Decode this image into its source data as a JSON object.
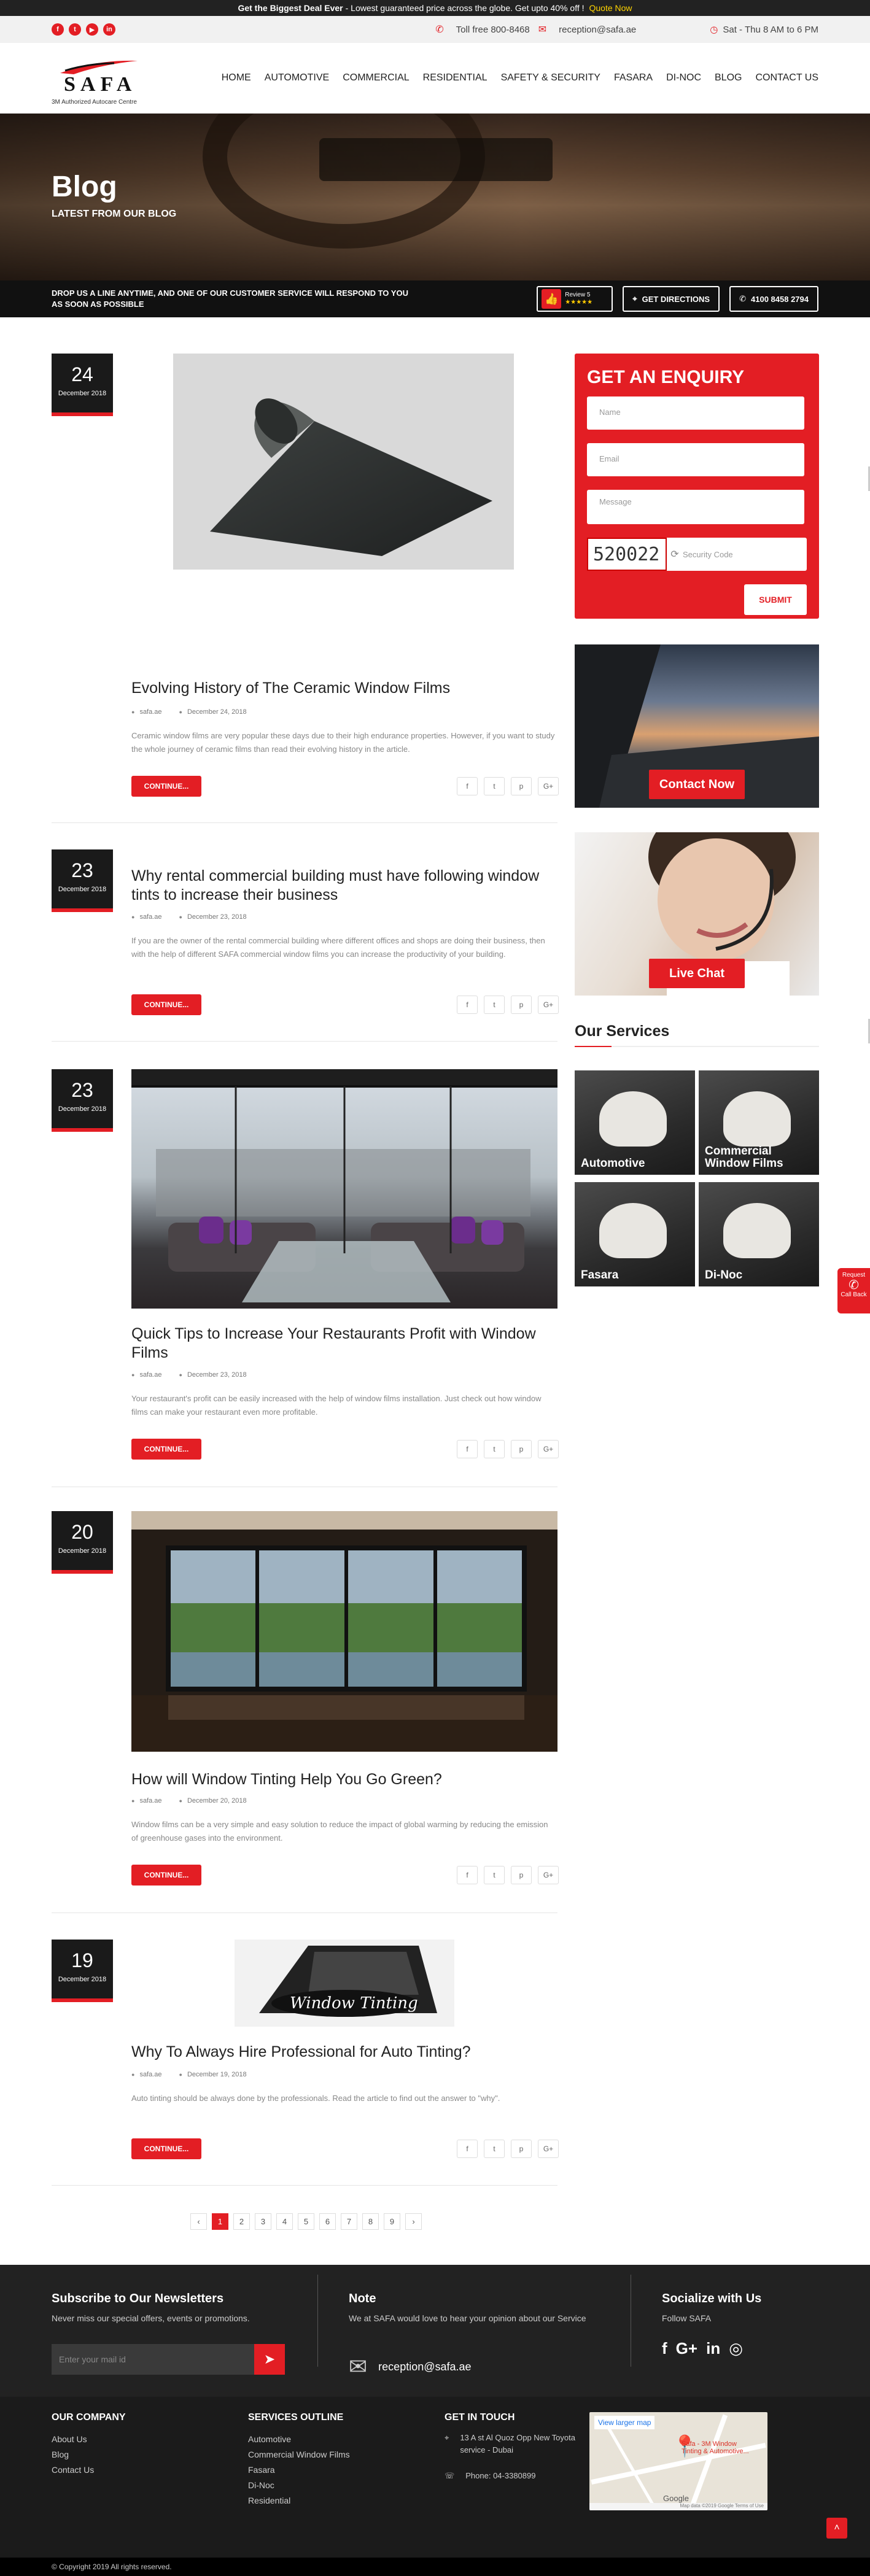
{
  "promo": {
    "bold": "Get the Biggest Deal Ever",
    "text": " - Lowest guaranteed price across the globe. Get upto 40% off !",
    "link": "Quote Now"
  },
  "topbar": {
    "social": [
      "f",
      "t",
      "▶",
      "in"
    ],
    "phone": "Toll free 800-8468",
    "email": "reception@safa.ae",
    "hours": "Sat - Thu 8 AM to 6 PM"
  },
  "logo": {
    "word": "SAFA",
    "tagline": "3M Authorized Autocare Centre"
  },
  "nav": [
    "HOME",
    "AUTOMOTIVE",
    "COMMERCIAL",
    "RESIDENTIAL",
    "SAFETY & SECURITY",
    "FASARA",
    "DI-NOC",
    "BLOG",
    "CONTACT US"
  ],
  "hero": {
    "title": "Blog",
    "subtitle": "LATEST FROM OUR BLOG"
  },
  "cta": {
    "text": "DROP US A LINE ANYTIME, AND ONE OF OUR CUSTOMER SERVICE WILL RESPOND TO YOU AS SOON AS POSSIBLE",
    "review": "Review 5",
    "stars": "★★★★★",
    "directions": "GET DIRECTIONS",
    "whatsapp": "4100 8458 2794"
  },
  "posts": [
    {
      "day": "24",
      "month": "December 2018",
      "title": "Evolving History of The Ceramic Window Films",
      "author": "safa.ae",
      "date": "December 24, 2018",
      "excerpt": "Ceramic window films are very popular these days due to their high endurance properties. However, if you want to study the whole journey of ceramic films than read their evolving history in the article.",
      "button": "CONTINUE..."
    },
    {
      "day": "23",
      "month": "December 2018",
      "title": "Why rental commercial building must have following window tints to increase their business",
      "author": "safa.ae",
      "date": "December 23, 2018",
      "excerpt": "If you are the owner of the rental commercial building where different offices and shops are doing their business, then with the help of different SAFA commercial window films you can increase the productivity of your building.",
      "button": "CONTINUE..."
    },
    {
      "day": "23",
      "month": "December 2018",
      "title": "Quick Tips to Increase Your Restaurants Profit with Window Films",
      "author": "safa.ae",
      "date": "December 23, 2018",
      "excerpt": "Your restaurant's profit can be easily increased with the help of window films installation. Just check out how window films can make your restaurant even more profitable.",
      "button": "CONTINUE..."
    },
    {
      "day": "20",
      "month": "December 2018",
      "title": "How will Window Tinting Help You Go Green?",
      "author": "safa.ae",
      "date": "December 20, 2018",
      "excerpt": "Window films can be a very simple and easy solution to reduce the impact of global warming by reducing the emission of greenhouse gases into the environment.",
      "button": "CONTINUE..."
    },
    {
      "day": "19",
      "month": "December 2018",
      "title": "Why To Always Hire Professional for Auto Tinting?",
      "author": "safa.ae",
      "date": "December 19, 2018",
      "excerpt": "Auto tinting should be always done by the professionals. Read the article to find out the answer to \"why\".",
      "button": "CONTINUE...",
      "image_text": "Window Tinting"
    }
  ],
  "share": [
    "f",
    "t",
    "p",
    "G+"
  ],
  "enquiry": {
    "title": "GET AN ENQUIRY",
    "name": "Name",
    "email": "Email",
    "message": "Message",
    "captcha": "520022",
    "security": "Security Code",
    "submit": "SUBMIT"
  },
  "side_promos": {
    "contact": "Contact Now",
    "chat": "Live Chat"
  },
  "services": {
    "heading": "Our Services",
    "items": [
      "Automotive",
      "Commercial Window Films",
      "Fasara",
      "Di-Noc"
    ]
  },
  "pagination": {
    "prev": "‹",
    "pages": [
      "1",
      "2",
      "3",
      "4",
      "5",
      "6",
      "7",
      "8",
      "9"
    ],
    "next": "›",
    "current": "1"
  },
  "footer": {
    "newsletter": {
      "title": "Subscribe to Our Newsletters",
      "text": "Never miss our special offers, events or promotions.",
      "placeholder": "Enter your mail id"
    },
    "note": {
      "title": "Note",
      "text": "We at SAFA would love to hear your opinion about our Service",
      "email": "reception@safa.ae"
    },
    "social": {
      "title": "Socialize with Us",
      "text": "Follow SAFA",
      "icons": [
        "f",
        "G+",
        "in",
        "◎"
      ]
    },
    "company": {
      "title": "OUR COMPANY",
      "links": [
        "About Us",
        "Blog",
        "Contact Us"
      ]
    },
    "services": {
      "title": "SERVICES OUTLINE",
      "links": [
        "Automotive",
        "Commercial Window Films",
        "Fasara",
        "Di-Noc",
        "Residential"
      ]
    },
    "touch": {
      "title": "GET IN TOUCH",
      "address": "13 A st Al Quoz Opp New Toyota service - Dubai",
      "phone": "Phone: 04-3380899"
    },
    "map": {
      "view": "View larger map",
      "business": "Safa - 3M Window Tinting & Automotive...",
      "google": "Google",
      "footer": "Map data ©2019 Google   Terms of Use"
    },
    "copyright": "© Copyright 2019 All rights reserved."
  },
  "callback": {
    "line1": "Request",
    "line2": "Call Back"
  },
  "colors": {
    "accent": "#e31e24",
    "dark": "#1a1a1a"
  }
}
